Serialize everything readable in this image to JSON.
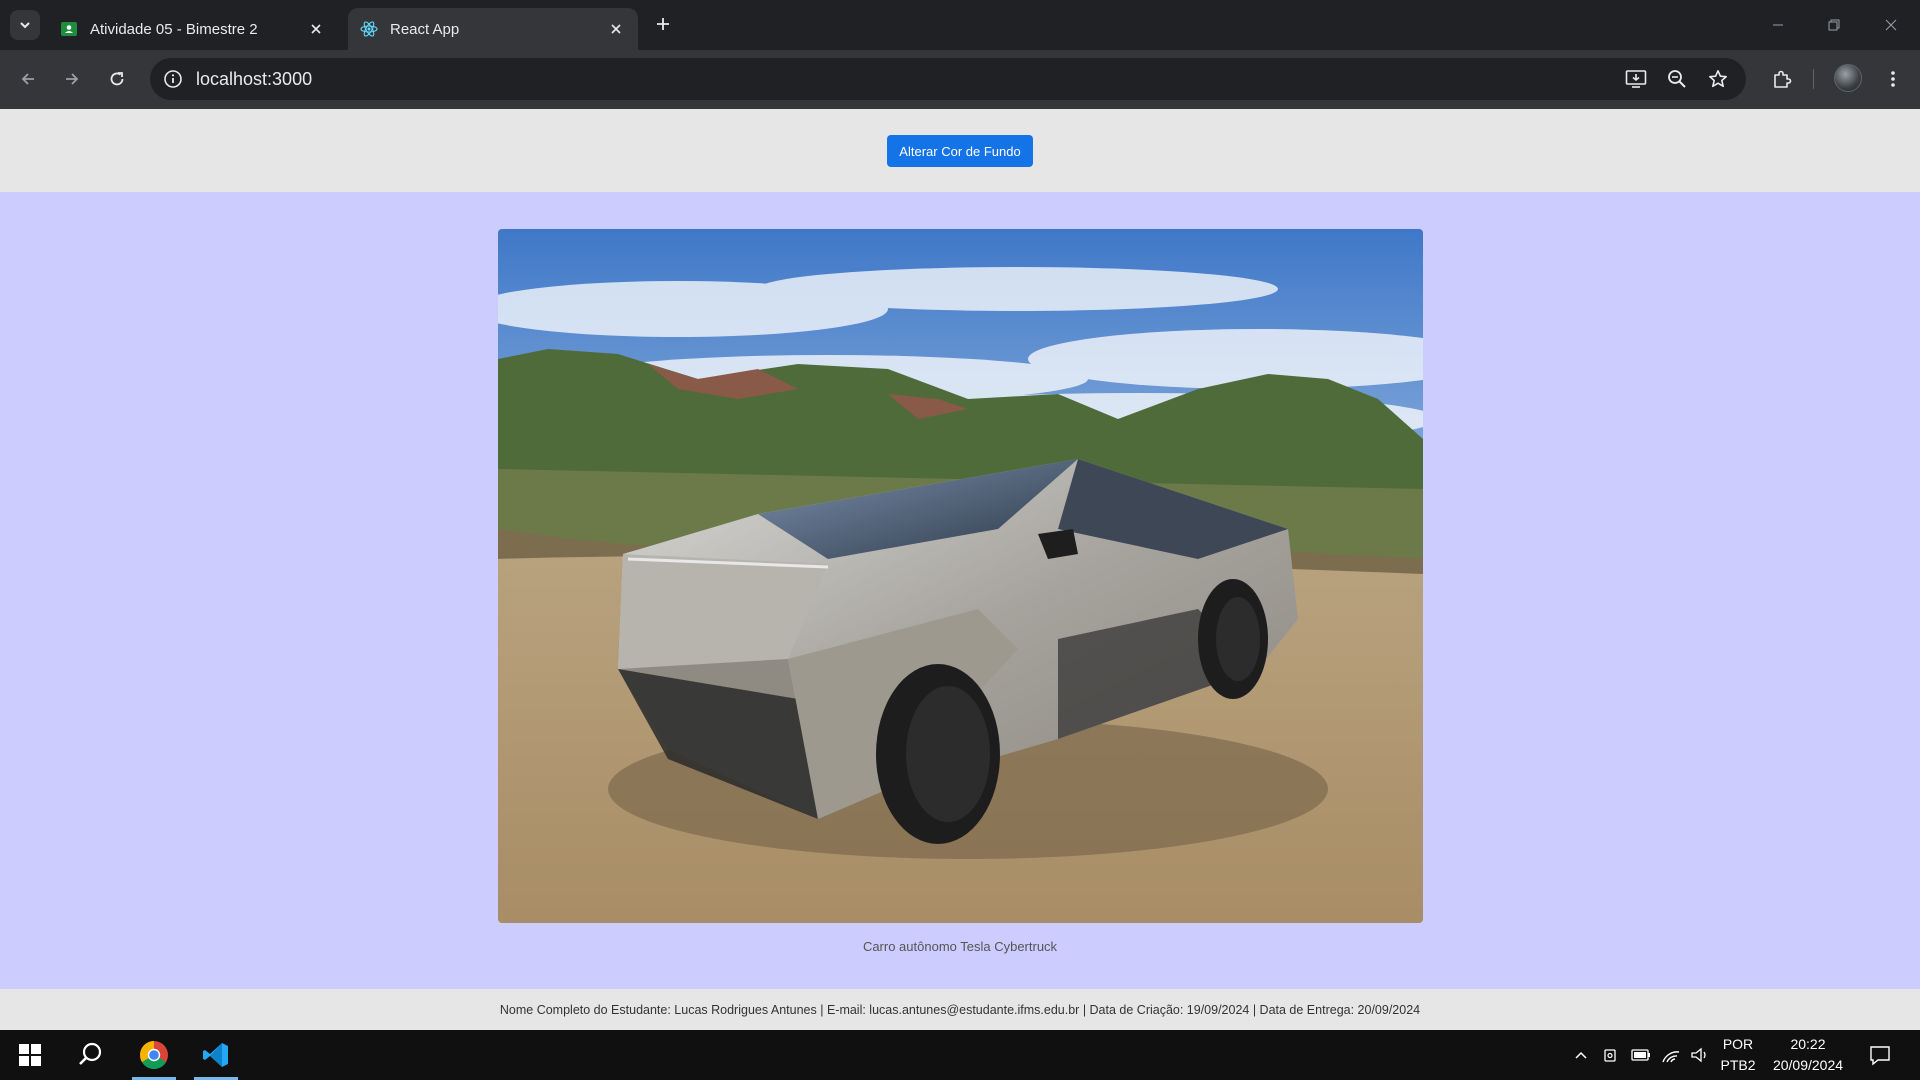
{
  "browser": {
    "tabs": [
      {
        "label": "Atividade 05 - Bimestre 2",
        "active": false
      },
      {
        "label": "React App",
        "active": true
      }
    ],
    "address": "localhost:3000",
    "accent": "#1473e6"
  },
  "page": {
    "background_color": "#ccccff",
    "button_label": "Alterar Cor de Fundo",
    "image_caption": "Carro autônomo Tesla Cybertruck",
    "footer": "Nome Completo do Estudante: Lucas Rodrigues Antunes | E-mail: lucas.antunes@estudante.ifms.edu.br | Data de Criação: 19/09/2024 | Data de Entrega: 20/09/2024"
  },
  "taskbar": {
    "apps": [
      "windows-start-icon",
      "search-icon",
      "chrome-icon",
      "vscode-icon"
    ],
    "language_top": "POR",
    "language_bottom": "PTB2",
    "time": "20:22",
    "date": "20/09/2024"
  }
}
